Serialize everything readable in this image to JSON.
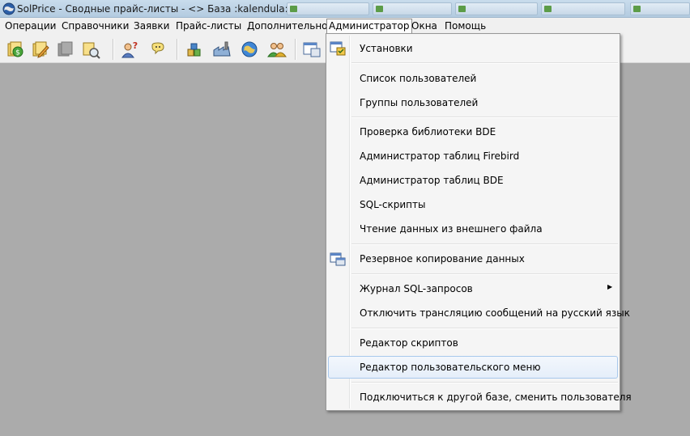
{
  "window": {
    "title": "SolPrice - Сводные прайс-листы - <> База :kalendula:"
  },
  "menubar": [
    {
      "id": "ops",
      "label": "Операции"
    },
    {
      "id": "refs",
      "label": "Справочники"
    },
    {
      "id": "orders",
      "label": "Заявки"
    },
    {
      "id": "prices",
      "label": "Прайс-листы"
    },
    {
      "id": "extra",
      "label": "Дополнительно"
    },
    {
      "id": "admin",
      "label": "Администратор"
    },
    {
      "id": "windows",
      "label": "Окна"
    },
    {
      "id": "help",
      "label": "Помощь"
    }
  ],
  "dropdown": {
    "items": [
      {
        "id": "settings",
        "label": "Установки",
        "icon": "settings-window-icon"
      },
      {
        "id": "users",
        "label": "Список пользователей"
      },
      {
        "id": "groups",
        "label": "Группы пользователей"
      },
      {
        "id": "bde-check",
        "label": "Проверка библиотеки BDE"
      },
      {
        "id": "firebird-admin",
        "label": "Администратор таблиц Firebird"
      },
      {
        "id": "bde-admin",
        "label": "Администратор таблиц BDE"
      },
      {
        "id": "sql-scripts",
        "label": "SQL-скрипты"
      },
      {
        "id": "read-external",
        "label": "Чтение данных из внешнего файла"
      },
      {
        "id": "backup",
        "label": "Резервное копирование данных",
        "icon": "backup-window-icon"
      },
      {
        "id": "sql-log",
        "label": "Журнал SQL-запросов",
        "submenu": true
      },
      {
        "id": "disable-translation",
        "label": "Отключить трансляцию сообщений на русский язык"
      },
      {
        "id": "script-editor",
        "label": "Редактор скриптов"
      },
      {
        "id": "user-menu-editor",
        "label": "Редактор пользовательского меню",
        "highlighted": true
      },
      {
        "id": "switch-db",
        "label": "Подключиться к другой базе, сменить пользователя"
      }
    ]
  },
  "colors": {
    "workspace": "#ababab",
    "menu_bg": "#f5f5f5",
    "highlight_border": "#a8c8ec"
  }
}
